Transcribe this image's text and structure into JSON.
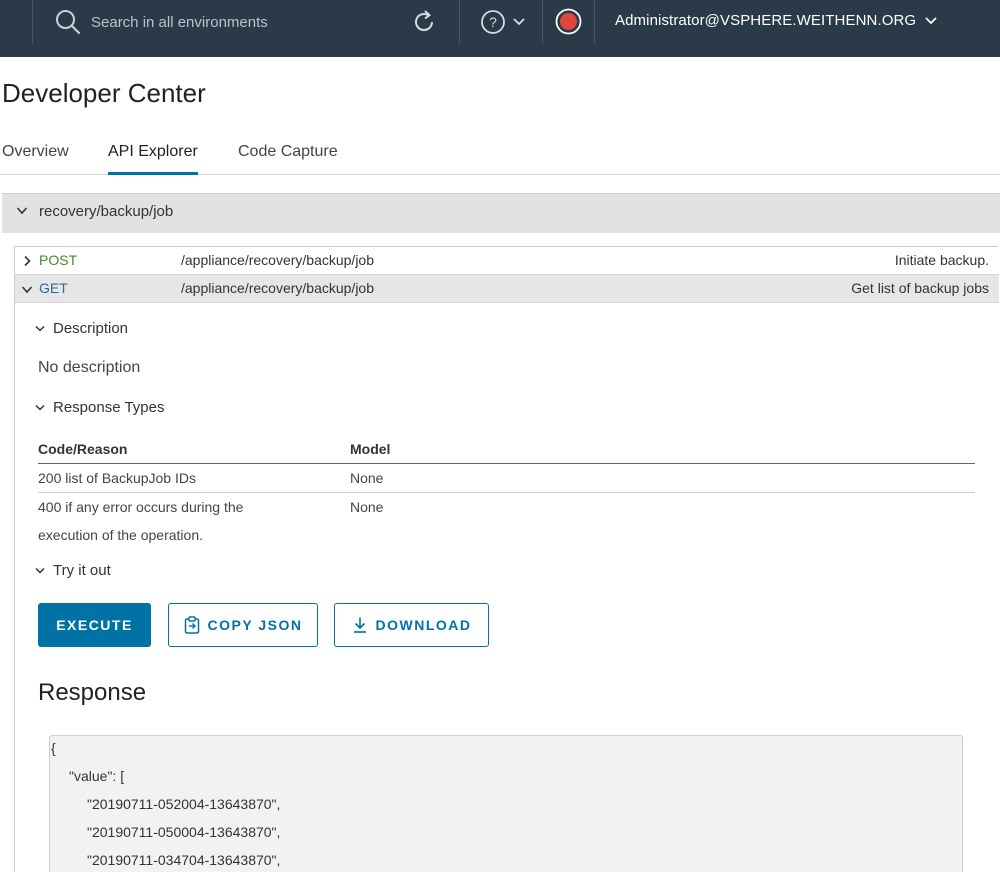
{
  "header": {
    "search_placeholder": "Search in all environments",
    "user": "Administrator@VSPHERE.WEITHENN.ORG",
    "icons": [
      "search-icon",
      "refresh-icon",
      "help-icon",
      "chevron-down-icon",
      "record-icon"
    ],
    "colors": {
      "bar": "#2b3a48",
      "record": "#e0463e"
    }
  },
  "page": {
    "title": "Developer Center"
  },
  "tabs": [
    {
      "label": "Overview",
      "active": false
    },
    {
      "label": "API Explorer",
      "active": true
    },
    {
      "label": "Code Capture",
      "active": false
    }
  ],
  "section": {
    "label": "recovery/backup/job"
  },
  "endpoints": [
    {
      "method": "POST",
      "path": "/appliance/recovery/backup/job",
      "description": "Initiate backup.",
      "expanded": false
    },
    {
      "method": "GET",
      "path": "/appliance/recovery/backup/job",
      "description": "Get list of backup jobs",
      "expanded": true
    }
  ],
  "details": {
    "description_heading": "Description",
    "description_text": "No description",
    "response_types_heading": "Response Types",
    "columns": [
      "Code/Reason",
      "Model"
    ],
    "rows": [
      {
        "code_lines": [
          "200 list of BackupJob IDs"
        ],
        "model": "None"
      },
      {
        "code_lines": [
          "400 if any error occurs during the",
          "execution of the operation."
        ],
        "model": "None"
      }
    ],
    "try_heading": "Try it out"
  },
  "buttons": {
    "execute": "EXECUTE",
    "copy_json": "COPY JSON",
    "download": "DOWNLOAD"
  },
  "response": {
    "title": "Response",
    "lines": [
      "{",
      "\"value\": [",
      "\"20190711-052004-13643870\",",
      "\"20190711-050004-13643870\",",
      "\"20190711-034704-13643870\","
    ]
  }
}
